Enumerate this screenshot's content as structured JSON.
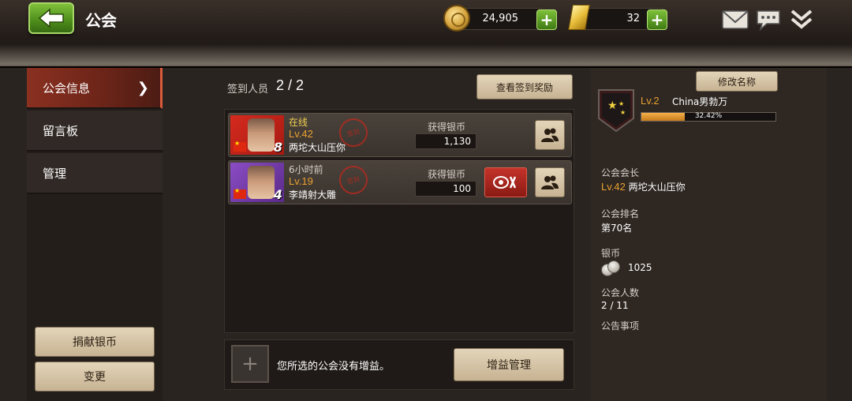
{
  "header": {
    "title": "公会",
    "silver_value": "24,905",
    "gold_value": "32"
  },
  "sidebar": {
    "items": [
      {
        "label": "公会信息",
        "active": true
      },
      {
        "label": "留言板",
        "active": false
      },
      {
        "label": "管理",
        "active": false
      }
    ],
    "donate_label": "捐献银币",
    "change_label": "变更"
  },
  "checkin": {
    "label": "签到人员",
    "count": "2 / 2",
    "reward_button": "查看签到奖励",
    "members": [
      {
        "status": "在线",
        "level": "Lv.42",
        "name": "两坨大山压你",
        "earn_label": "获得银币",
        "earned": "1,130",
        "rank_number": "8",
        "stamp": "签到"
      },
      {
        "status": "6小时前",
        "level": "Lv.19",
        "name": "李靖射大雕",
        "earn_label": "获得银币",
        "earned": "100",
        "rank_number": "4",
        "stamp": "签到"
      }
    ]
  },
  "buff": {
    "text": "您所选的公会没有增益。",
    "button": "增益管理"
  },
  "guild": {
    "rename_button": "修改名称",
    "level": "Lv.2",
    "name": "China男勃万",
    "progress_text": "32.42%",
    "progress_value": 32.42,
    "leader_label": "公会会长",
    "leader_level": "Lv.42",
    "leader_name": "两坨大山压你",
    "rank_label": "公会排名",
    "rank_value": "第70名",
    "silver_label": "银币",
    "silver_value": "1025",
    "members_label": "公会人数",
    "members_value": "2 / 11",
    "notice_label": "公告事项"
  },
  "colors": {
    "accent_active": "#8a3020",
    "level_orange": "#e8a030",
    "online_yellow": "#f0d050",
    "plus_green": "#4d8d1b"
  }
}
